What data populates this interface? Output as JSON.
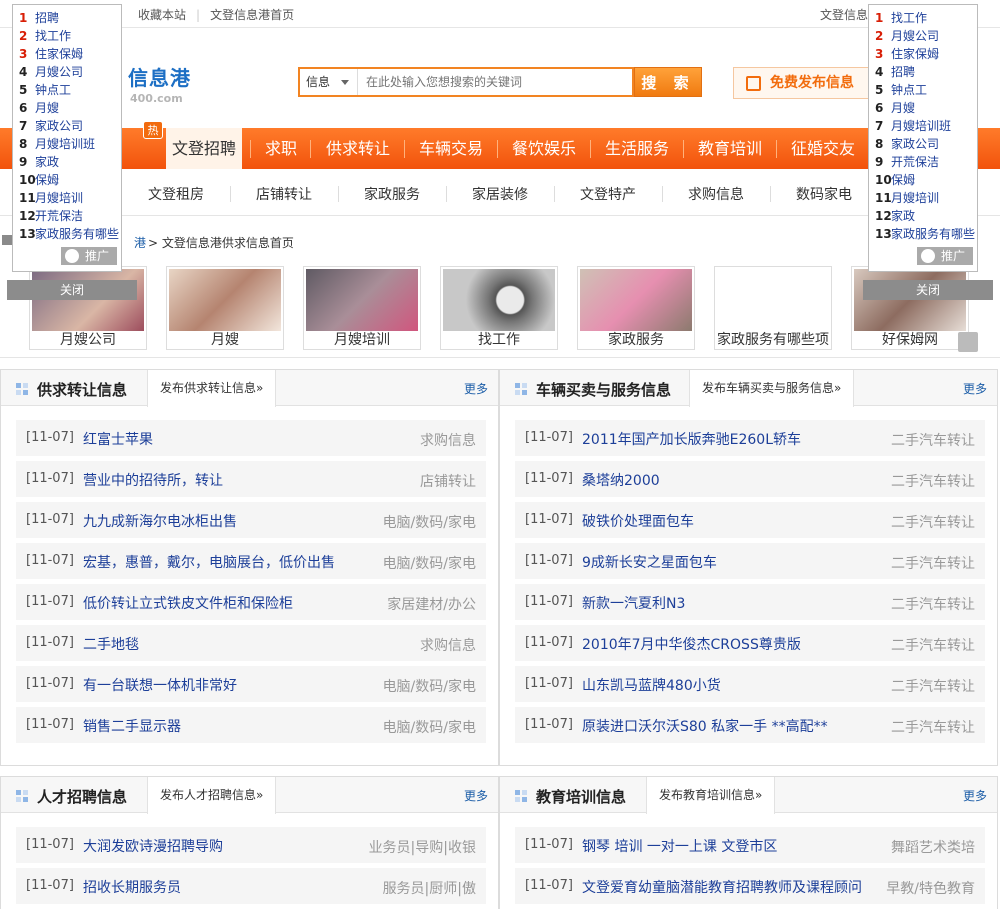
{
  "topbar": {
    "left_items": [
      "收藏本站",
      "文登信息港首页"
    ],
    "right_item": "文登信息"
  },
  "header": {
    "logo": "信息港",
    "logo_sub": "400.com",
    "search_select": "信息",
    "search_placeholder": "在此处输入您想搜索的关键词",
    "search_button": "搜 索",
    "publish_button": "免费发布信息"
  },
  "main_nav": {
    "hot_badge": "热",
    "items": [
      "文登招聘",
      "求职",
      "供求转让",
      "车辆交易",
      "餐饮娱乐",
      "生活服务",
      "教育培训",
      "征婚交友"
    ]
  },
  "sub_nav": [
    "文登租房",
    "店铺转让",
    "家政服务",
    "家居装修",
    "文登特产",
    "求购信息",
    "数码家电"
  ],
  "breadcrumb": {
    "link": "港",
    "current": "> 文登信息港供求信息首页"
  },
  "image_strip": [
    "月嫂公司",
    "月嫂",
    "月嫂培训",
    "找工作",
    "家政服务",
    "家政服务有哪些项",
    "好保姆网"
  ],
  "float_left": {
    "items": [
      {
        "n": "1",
        "t": "招聘"
      },
      {
        "n": "2",
        "t": "找工作"
      },
      {
        "n": "3",
        "t": "住家保姆"
      },
      {
        "n": "4",
        "t": "月嫂公司"
      },
      {
        "n": "5",
        "t": "钟点工"
      },
      {
        "n": "6",
        "t": "月嫂"
      },
      {
        "n": "7",
        "t": "家政公司"
      },
      {
        "n": "8",
        "t": "月嫂培训班"
      },
      {
        "n": "9",
        "t": "家政"
      },
      {
        "n": "10",
        "t": "保姆"
      },
      {
        "n": "11",
        "t": "月嫂培训"
      },
      {
        "n": "12",
        "t": "开荒保洁"
      },
      {
        "n": "13",
        "t": "家政服务有哪些"
      }
    ],
    "promo": "推广",
    "close": "关闭"
  },
  "float_right": {
    "items": [
      {
        "n": "1",
        "t": "找工作"
      },
      {
        "n": "2",
        "t": "月嫂公司"
      },
      {
        "n": "3",
        "t": "住家保姆"
      },
      {
        "n": "4",
        "t": "招聘"
      },
      {
        "n": "5",
        "t": "钟点工"
      },
      {
        "n": "6",
        "t": "月嫂"
      },
      {
        "n": "7",
        "t": "月嫂培训班"
      },
      {
        "n": "8",
        "t": "家政公司"
      },
      {
        "n": "9",
        "t": "开荒保洁"
      },
      {
        "n": "10",
        "t": "保姆"
      },
      {
        "n": "11",
        "t": "月嫂培训"
      },
      {
        "n": "12",
        "t": "家政"
      },
      {
        "n": "13",
        "t": "家政服务有哪些"
      }
    ],
    "promo": "推广",
    "close": "关闭"
  },
  "panels": {
    "supply": {
      "title": "供求转让信息",
      "tab": "发布供求转让信息»",
      "more": "更多",
      "rows": [
        {
          "date": "[11-07]",
          "text": "红富士苹果",
          "cat": "求购信息"
        },
        {
          "date": "[11-07]",
          "text": "营业中的招待所，转让",
          "cat": "店铺转让"
        },
        {
          "date": "[11-07]",
          "text": "九九成新海尔电冰柜出售",
          "cat": "电脑/数码/家电"
        },
        {
          "date": "[11-07]",
          "text": "宏基，惠普，戴尔，电脑展台，低价出售",
          "cat": "电脑/数码/家电"
        },
        {
          "date": "[11-07]",
          "text": "低价转让立式铁皮文件柜和保险柜",
          "cat": "家居建材/办公"
        },
        {
          "date": "[11-07]",
          "text": "二手地毯",
          "cat": "求购信息"
        },
        {
          "date": "[11-07]",
          "text": "有一台联想一体机非常好",
          "cat": "电脑/数码/家电"
        },
        {
          "date": "[11-07]",
          "text": "销售二手显示器",
          "cat": "电脑/数码/家电"
        }
      ]
    },
    "vehicle": {
      "title": "车辆买卖与服务信息",
      "tab": "发布车辆买卖与服务信息»",
      "more": "更多",
      "rows": [
        {
          "date": "[11-07]",
          "text": "2011年国产加长版奔驰E260L轿车",
          "cat": "二手汽车转让"
        },
        {
          "date": "[11-07]",
          "text": "桑塔纳2000",
          "cat": "二手汽车转让"
        },
        {
          "date": "[11-07]",
          "text": "破铁价处理面包车",
          "cat": "二手汽车转让"
        },
        {
          "date": "[11-07]",
          "text": "9成新长安之星面包车",
          "cat": "二手汽车转让"
        },
        {
          "date": "[11-07]",
          "text": "新款一汽夏利N3",
          "cat": "二手汽车转让"
        },
        {
          "date": "[11-07]",
          "text": "2010年7月中华俊杰CROSS尊贵版",
          "cat": "二手汽车转让"
        },
        {
          "date": "[11-07]",
          "text": "山东凯马蓝牌480小货",
          "cat": "二手汽车转让"
        },
        {
          "date": "[11-07]",
          "text": "原装进口沃尔沃S80 私家一手 **高配**",
          "cat": "二手汽车转让"
        }
      ]
    },
    "talent": {
      "title": "人才招聘信息",
      "tab": "发布人才招聘信息»",
      "more": "更多",
      "rows": [
        {
          "date": "[11-07]",
          "text": "大润发欧诗漫招聘导购",
          "cat": "业务员|导购|收银"
        },
        {
          "date": "[11-07]",
          "text": "招收长期服务员",
          "cat": "服务员|厨师|傲"
        }
      ]
    },
    "education": {
      "title": "教育培训信息",
      "tab": "发布教育培训信息»",
      "more": "更多",
      "rows": [
        {
          "date": "[11-07]",
          "text": "钢琴  培训  一对一上课  文登市区",
          "cat": "舞蹈艺术类培"
        },
        {
          "date": "[11-07]",
          "text": "文登爱育幼童脑潜能教育招聘教师及课程顾问",
          "cat": "早教/特色教育"
        }
      ]
    }
  }
}
